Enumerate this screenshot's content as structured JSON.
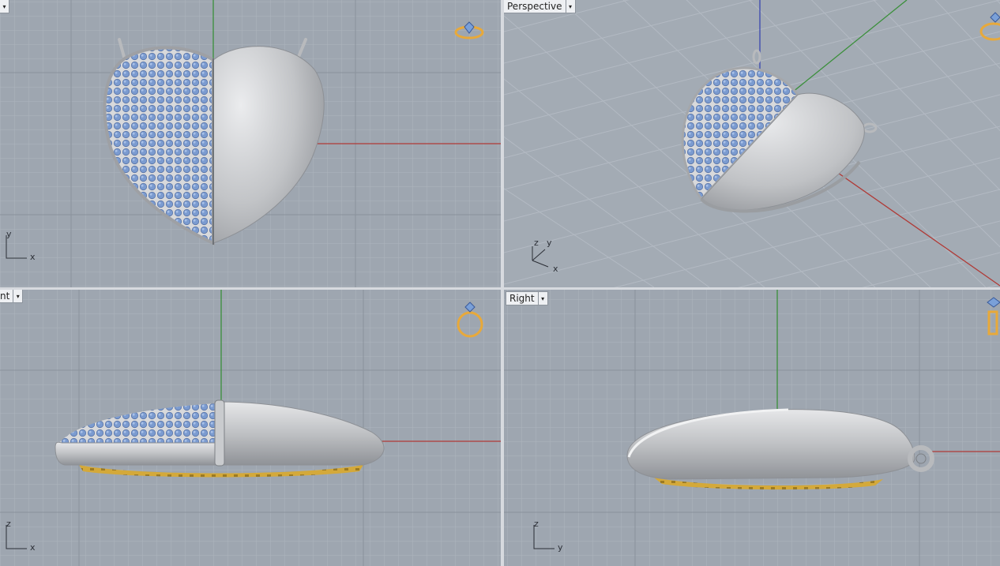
{
  "viewports": {
    "top": {
      "label": "",
      "axis": {
        "vertical": "y",
        "horizontal": "x"
      }
    },
    "perspective": {
      "label": "Perspective",
      "axis": {
        "z": "z",
        "y": "y",
        "x": "x"
      }
    },
    "front": {
      "label": "nt",
      "axis": {
        "vertical": "z",
        "horizontal": "x"
      }
    },
    "right": {
      "label": "Right",
      "axis": {
        "vertical": "z",
        "horizontal": "y"
      }
    }
  },
  "icons": {
    "dropdown": "▾",
    "nav_gizmo": "ring-gizmo-icon"
  },
  "colors": {
    "viewport_bg": "#9ea6b0",
    "grid_minor": "#aeb5be",
    "grid_major": "#8a929c",
    "x_axis": "#b03a36",
    "y_axis": "#3a8f3a",
    "z_axis": "#3a46b0",
    "metal": "#c4c6c9",
    "gem": "#7b9bd0",
    "gold": "#d4a93a",
    "label_bg": "#eef0f3"
  }
}
